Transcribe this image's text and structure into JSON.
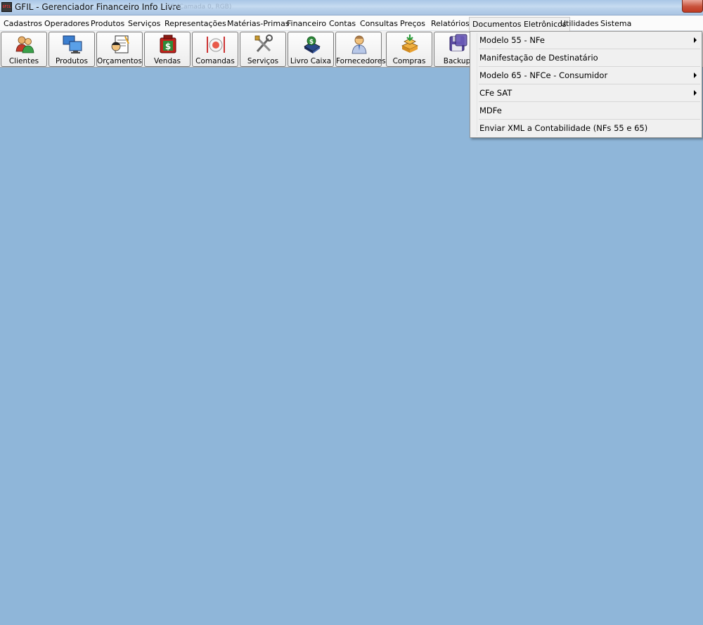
{
  "window": {
    "title": "GFIL - Gerenciador Financeiro Info Livre",
    "title_ghost": "75 (Camada 0, RGB)",
    "app_icon_text": "GFIL"
  },
  "menubar": {
    "items": [
      {
        "label": "Cadastros"
      },
      {
        "label": "Operadores"
      },
      {
        "label": "Produtos"
      },
      {
        "label": "Serviços"
      },
      {
        "label": "Representações"
      },
      {
        "label": "Matérias-Primas"
      },
      {
        "label": "Financeiro"
      },
      {
        "label": "Contas"
      },
      {
        "label": "Consultas"
      },
      {
        "label": "Preços"
      },
      {
        "label": "Relatórios"
      },
      {
        "label": "Documentos Eletrônicos",
        "open": true
      },
      {
        "label": "Utilidades"
      },
      {
        "label": "Sistema"
      }
    ]
  },
  "toolbar": {
    "buttons": [
      {
        "label": "Clientes",
        "icon": "users-icon"
      },
      {
        "label": "Produtos",
        "icon": "monitors-icon"
      },
      {
        "label": "Orçamentos",
        "icon": "notepad-icon"
      },
      {
        "label": "Vendas",
        "icon": "money-bag-icon"
      },
      {
        "label": "Comandas",
        "icon": "plate-icon"
      },
      {
        "label": "Serviços",
        "icon": "tools-icon"
      },
      {
        "label": "Livro Caixa",
        "icon": "ledger-icon"
      },
      {
        "label": "Fornecedores",
        "icon": "person-icon"
      },
      {
        "label": "Compras",
        "icon": "boxes-icon"
      },
      {
        "label": "Backup",
        "icon": "floppy-icon"
      }
    ]
  },
  "dropdown": {
    "items": [
      {
        "label": "Modelo 55 - NFe",
        "submenu": true
      },
      {
        "label": "Manifestação de Destinatário",
        "submenu": false
      },
      {
        "label": "Modelo 65 - NFCe - Consumidor",
        "submenu": true
      },
      {
        "label": "CFe SAT",
        "submenu": true
      },
      {
        "label": "MDFe",
        "submenu": false
      },
      {
        "label": "Enviar XML a Contabilidade (NFs 55 e 65)",
        "submenu": false
      }
    ]
  },
  "colors": {
    "workspace": "#8fb6d9",
    "menubar": "#fbfbfb",
    "toolbar": "#f0f0f0"
  }
}
